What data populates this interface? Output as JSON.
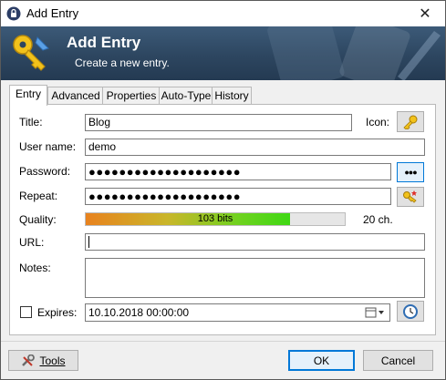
{
  "window": {
    "title": "Add Entry",
    "close_glyph": "✕"
  },
  "banner": {
    "title": "Add Entry",
    "subtitle": "Create a new entry."
  },
  "tabs": [
    {
      "label": "Entry",
      "active": true
    },
    {
      "label": "Advanced"
    },
    {
      "label": "Properties"
    },
    {
      "label": "Auto-Type"
    },
    {
      "label": "History"
    }
  ],
  "form": {
    "title_label": "Title:",
    "title_value": "Blog",
    "icon_label": "Icon:",
    "username_label": "User name:",
    "username_value": "demo",
    "password_label": "Password:",
    "password_value": "●●●●●●●●●●●●●●●●●●●●",
    "reveal_glyph": "●●●",
    "repeat_label": "Repeat:",
    "repeat_value": "●●●●●●●●●●●●●●●●●●●●",
    "quality_label": "Quality:",
    "quality_text": "103 bits",
    "quality_fraction": 0.79,
    "length_text": "20 ch.",
    "url_label": "URL:",
    "url_value": "",
    "notes_label": "Notes:",
    "notes_value": "",
    "expires_label": "Expires:",
    "expires_value": "10.10.2018 00:00:00"
  },
  "footer": {
    "tools_label": "Tools",
    "ok_label": "OK",
    "cancel_label": "Cancel"
  },
  "colors": {
    "banner": "#2d4660",
    "accent_blue": "#0078d7"
  }
}
